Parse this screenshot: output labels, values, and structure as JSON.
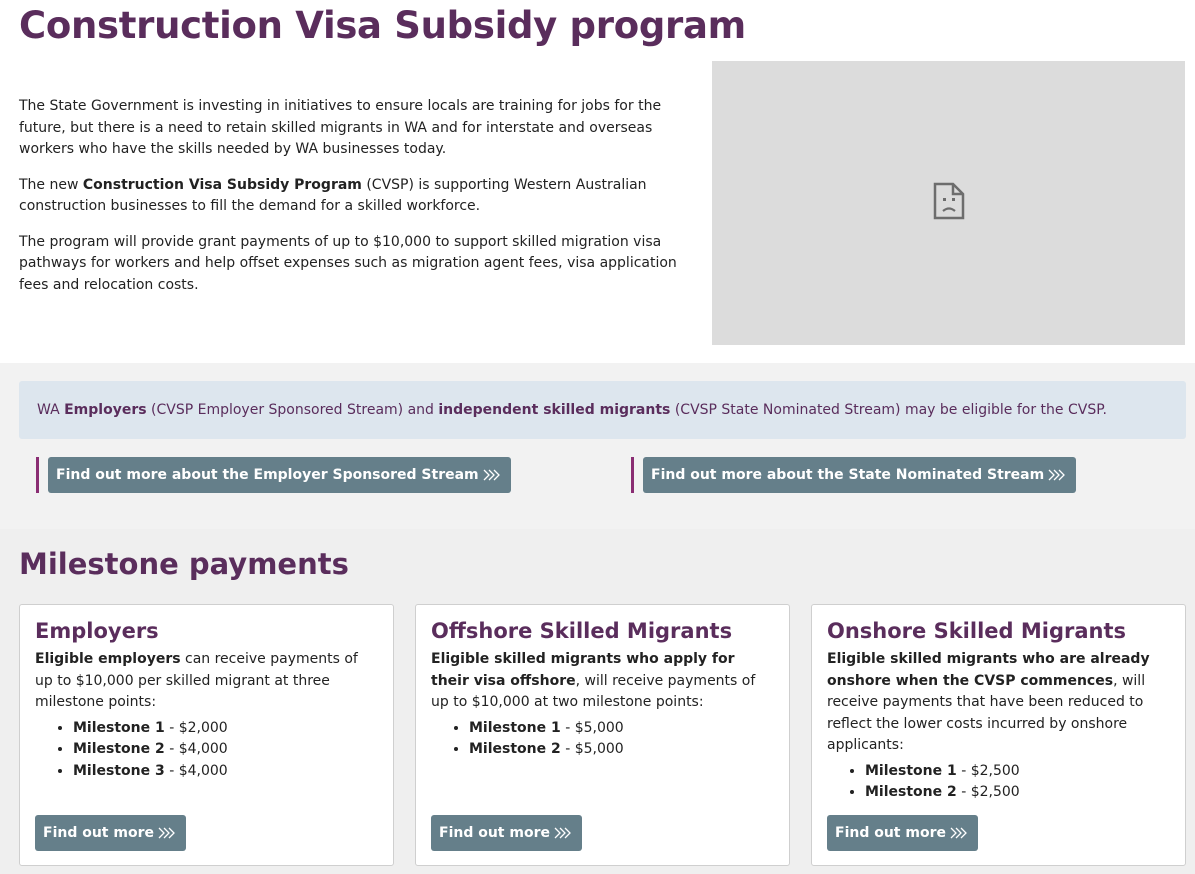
{
  "page": {
    "title": "Construction Visa Subsidy program"
  },
  "intro": {
    "p1": "The State Government is investing in initiatives to ensure locals are training for jobs for the future, but there is a need to retain skilled migrants in WA and for interstate and overseas workers who have the skills needed by WA businesses today.",
    "p2_prefix": "The new ",
    "p2_bold": "Construction Visa Subsidy Program",
    "p2_suffix": " (CVSP) is supporting Western Australian construction businesses to fill the demand for a skilled workforce.",
    "p3": "The program will provide grant payments of up to $10,000 to support skilled migration visa pathways for workers and help offset expenses such as migration agent fees, visa application fees and relocation costs."
  },
  "media": {
    "icon": "broken-document-icon"
  },
  "banner": {
    "part1": "WA ",
    "bold1": "Employers",
    "part2": " (CVSP Employer Sponsored Stream) and ",
    "bold2": "independent skilled migrants",
    "part3": " (CVSP State Nominated Stream) may be eligible for the CVSP."
  },
  "streams": {
    "employer_label": "Find out more about the Employer Sponsored Stream",
    "state_label": "Find out more about the State Nominated Stream"
  },
  "milestones": {
    "title": "Milestone payments",
    "cards": [
      {
        "title": "Employers",
        "desc_bold": "Eligible employers",
        "desc_rest": " can receive payments of up to $10,000 per skilled migrant at three milestone points:",
        "items": [
          {
            "label": "Milestone 1",
            "value": " - $2,000"
          },
          {
            "label": "Milestone 2",
            "value": " - $4,000"
          },
          {
            "label": "Milestone 3",
            "value": " - $4,000"
          }
        ],
        "button": "Find out more"
      },
      {
        "title": "Offshore Skilled Migrants",
        "desc_bold": "Eligible skilled migrants who apply for their visa offshore",
        "desc_rest": ", will receive payments of up to $10,000 at two milestone points:",
        "items": [
          {
            "label": "Milestone 1",
            "value": " - $5,000"
          },
          {
            "label": "Milestone 2",
            "value": " - $5,000"
          }
        ],
        "button": "Find out more"
      },
      {
        "title": "Onshore Skilled Migrants",
        "desc_bold": "Eligible skilled migrants who are already onshore when the CVSP commences",
        "desc_rest": ", will receive payments that have been reduced to reflect the lower costs incurred by onshore applicants:",
        "items": [
          {
            "label": "Milestone 1",
            "value": " - $2,500"
          },
          {
            "label": "Milestone 2",
            "value": " - $2,500"
          }
        ],
        "button": "Find out more"
      }
    ]
  },
  "colors": {
    "heading": "#5a2d5c",
    "button": "#657f8a",
    "accent_bar": "#8a2d73",
    "banner_bg": "#dde6ee"
  }
}
